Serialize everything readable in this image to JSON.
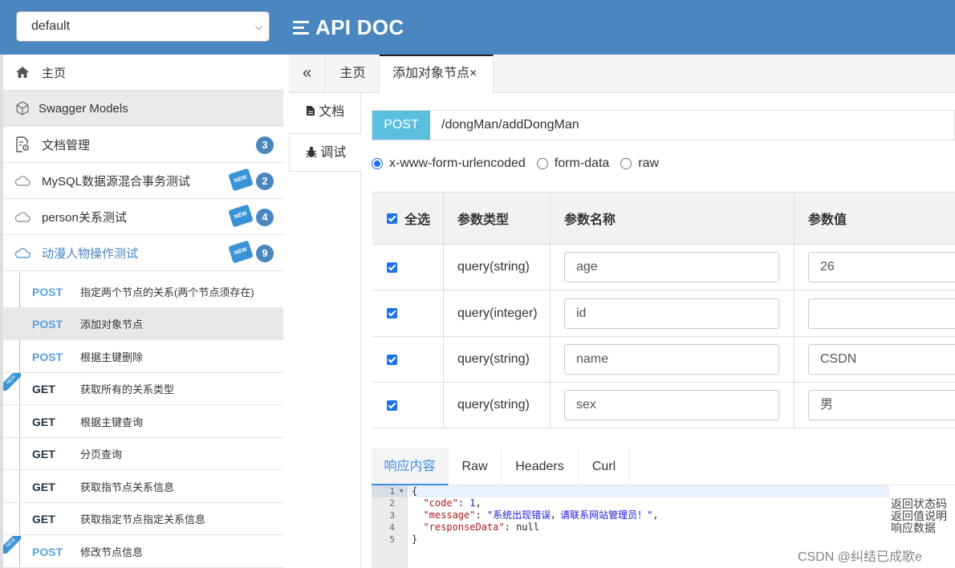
{
  "header": {
    "group_select": "default",
    "brand": "API DOC"
  },
  "sidebar": {
    "groups": [
      {
        "label": "主页",
        "icon": "home-icon"
      },
      {
        "label": "Swagger Models",
        "icon": "cube-icon"
      },
      {
        "label": "文档管理",
        "icon": "doc-settings-icon",
        "count": "3"
      },
      {
        "label": "MySQL数据源混合事务测试",
        "icon": "cloud-icon",
        "count": "2",
        "badge": "NEW"
      },
      {
        "label": "person关系测试",
        "icon": "cloud-icon",
        "count": "4",
        "badge": "NEW"
      },
      {
        "label": "动漫人物操作测试",
        "icon": "cloud-icon",
        "count": "9",
        "badge": "NEW"
      }
    ],
    "apis": [
      {
        "method": "POST",
        "label": "指定两个节点的关系(两个节点须存在)"
      },
      {
        "method": "POST",
        "label": "添加对象节点"
      },
      {
        "method": "POST",
        "label": "根据主键删除"
      },
      {
        "method": "GET",
        "label": "获取所有的关系类型",
        "corner": "NEW"
      },
      {
        "method": "GET",
        "label": "根据主键查询"
      },
      {
        "method": "GET",
        "label": "分页查询"
      },
      {
        "method": "GET",
        "label": "获取指节点关系信息"
      },
      {
        "method": "GET",
        "label": "获取指定节点指定关系信息"
      },
      {
        "method": "POST",
        "label": "修改节点信息",
        "corner": "NEW"
      }
    ]
  },
  "tabs": {
    "collapse": "«",
    "home": "主页",
    "active": "添加对象节点×"
  },
  "vtabs": {
    "doc": "文档",
    "debug": "调试"
  },
  "request": {
    "method": "POST",
    "url": "/dongMan/addDongMan",
    "content_types": [
      "x-www-form-urlencoded",
      "form-data",
      "raw"
    ],
    "selected_content_type": "x-www-form-urlencoded"
  },
  "params": {
    "headers": [
      "全选",
      "参数类型",
      "参数名称",
      "参数值"
    ],
    "rows": [
      {
        "type": "query(string)",
        "name": "age",
        "value": "26"
      },
      {
        "type": "query(integer)",
        "name": "id",
        "value": ""
      },
      {
        "type": "query(string)",
        "name": "name",
        "value": "CSDN"
      },
      {
        "type": "query(string)",
        "name": "sex",
        "value": "男"
      }
    ]
  },
  "response": {
    "tabs": [
      "响应内容",
      "Raw",
      "Headers",
      "Curl"
    ],
    "line_numbers": [
      "1",
      "2",
      "3",
      "4",
      "5"
    ],
    "code": {
      "open": "{",
      "code_key": "\"code\"",
      "code_val": "1",
      "message_key": "\"message\"",
      "message_val": "\"系统出现错误，请联系网站管理员！\"",
      "data_key": "\"responseData\"",
      "data_val": "null",
      "close": "}"
    },
    "side_labels": [
      "返回状态码",
      "返回值说明",
      "响应数据"
    ]
  },
  "watermark": "CSDN @纠结已成歌e"
}
